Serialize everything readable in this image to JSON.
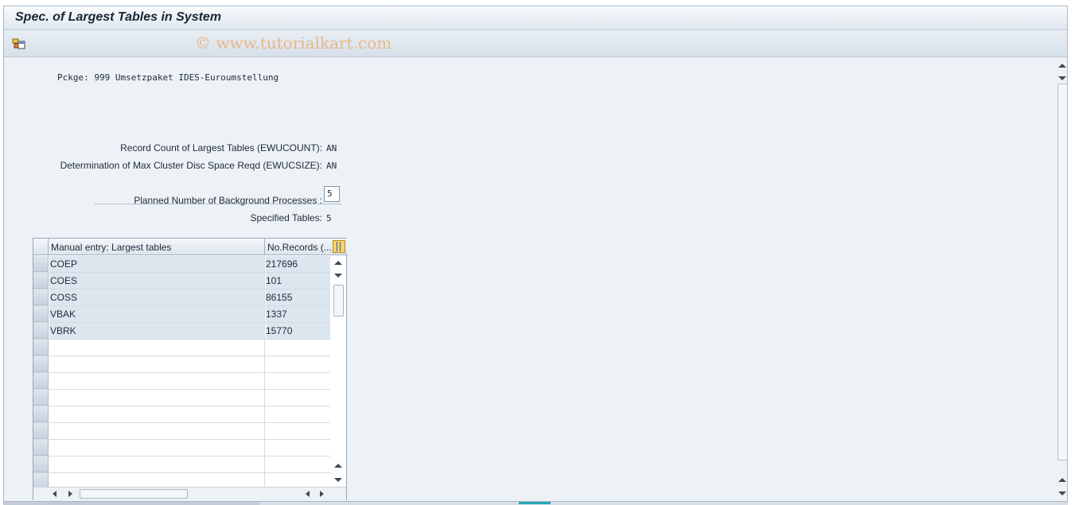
{
  "window": {
    "title": "Spec. of Largest Tables in System"
  },
  "toolbar": {
    "watermark": "© www.tutorialkart.com",
    "icon": "layout-settings-icon"
  },
  "header": {
    "package_line": "Pckge: 999 Umsetzpaket IDES-Euroumstellung"
  },
  "fields": {
    "record_count_label": "Record Count of Largest Tables (EWUCOUNT):",
    "record_count_value": "AN",
    "max_cluster_label": "Determination of Max Cluster Disc Space Reqd (EWUCSIZE):",
    "max_cluster_value": "AN",
    "bg_processes_label": "Planned Number of Background Processes :",
    "bg_processes_value": "5",
    "specified_tables_label": "Specified Tables:",
    "specified_tables_value": "5"
  },
  "table": {
    "col1_header": "Manual entry: Largest tables",
    "col2_header": "No.Records (...",
    "rows": [
      {
        "name": "COEP",
        "records": "217696"
      },
      {
        "name": "COES",
        "records": "101"
      },
      {
        "name": "COSS",
        "records": "86155"
      },
      {
        "name": "VBAK",
        "records": "1337"
      },
      {
        "name": "VBRK",
        "records": "15770"
      },
      {
        "name": "",
        "records": ""
      },
      {
        "name": "",
        "records": ""
      },
      {
        "name": "",
        "records": ""
      },
      {
        "name": "",
        "records": ""
      },
      {
        "name": "",
        "records": ""
      },
      {
        "name": "",
        "records": ""
      },
      {
        "name": "",
        "records": ""
      },
      {
        "name": "",
        "records": ""
      },
      {
        "name": "",
        "records": ""
      }
    ]
  }
}
